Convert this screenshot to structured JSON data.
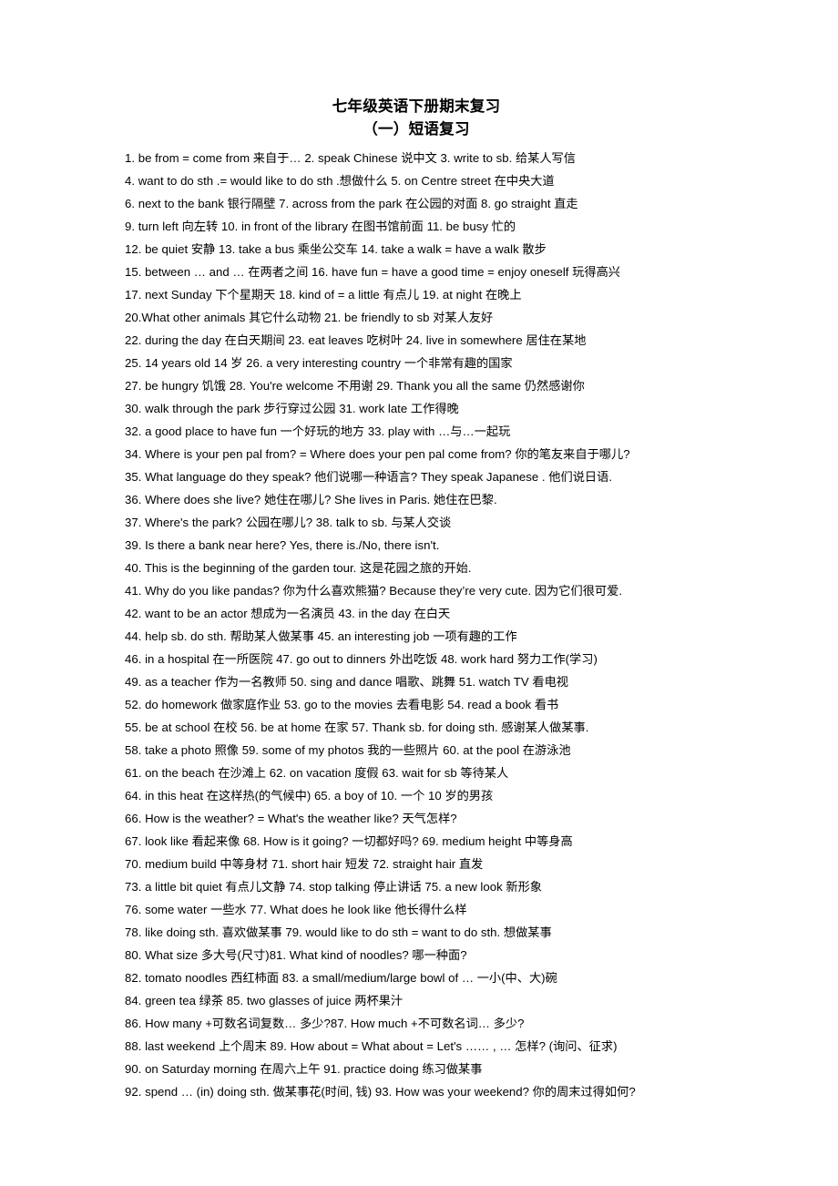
{
  "document": {
    "title_lines": [
      "七年级英语下册期末复习",
      "（一）短语复习"
    ],
    "lines": [
      "1. be from = come from 来自于…     2. speak Chinese 说中文   3. write to sb. 给某人写信",
      "4. want to do sth .= would like to do sth .想做什么      5. on Centre street 在中央大道",
      "6. next to the bank 银行隔壁   7. across from the park 在公园的对面   8. go straight 直走",
      "9. turn left 向左转     10. in front of the library 在图书馆前面     11. be busy 忙的",
      "12. be quiet 安静   13. take a bus 乘坐公交车      14. take a walk = have a walk 散步",
      "15. between … and … 在两者之间  16. have fun = have a good time = enjoy oneself 玩得高兴",
      "17. next Sunday 下个星期天     18. kind of = a little 有点儿      19. at night 在晚上",
      "20.What other animals 其它什么动物      21. be friendly to sb 对某人友好",
      "22. during the day 在白天期间     23. eat leaves 吃树叶    24. live in somewhere 居住在某地",
      "25. 14 years old  14 岁           26. a very interesting country 一个非常有趣的国家",
      "27. be hungry 饥饿   28. You're welcome 不用谢   29. Thank you all the same 仍然感谢你",
      "30. walk through the park 步行穿过公园      31. work late 工作得晚",
      "32. a good place to have fun 一个好玩的地方       33. play with …与…一起玩",
      "34. Where is your pen pal from? = Where does your pen pal come from?  你的笔友来自于哪儿?",
      "35. What language do they speak? 他们说哪一种语言?   They speak Japanese . 他们说日语.",
      "36. Where does she live? 她住在哪儿?      She lives in Paris. 她住在巴黎.",
      "37. Where's the park? 公园在哪儿?      38. talk to sb. 与某人交谈",
      "39. Is there a bank near here? Yes, there is./No, there isn't.",
      "40. This is the beginning of the garden tour. 这是花园之旅的开始.",
      "41. Why do you like pandas? 你为什么喜欢熊猫?  Because they’re very cute. 因为它们很可爱.",
      "42. want to be an actor 想成为一名演员       43. in the day 在白天",
      "44. help sb. do sth. 帮助某人做某事    45. an interesting job 一项有趣的工作",
      "46. in a hospital 在一所医院  47. go out to dinners 外出吃饭  48. work hard 努力工作(学习)",
      "49. as a teacher 作为一名教师   50. sing and dance 唱歌、跳舞    51. watch TV 看电视",
      "52. do homework 做家庭作业  53. go to the movies 去看电影    54. read a book 看书",
      "55. be at school 在校  56. be at home 在家  57. Thank sb. for doing sth. 感谢某人做某事.",
      "58. take a photo 照像    59. some of my photos 我的一些照片    60. at the pool 在游泳池",
      "61. on the beach 在沙滩上   62. on vacation 度假    63. wait for sb 等待某人",
      "64. in this heat 在这样热(的气候中)     65. a boy of 10.  一个 10 岁的男孩",
      "66. How is the weather? = What's the weather like? 天气怎样?",
      "67. look like 看起来像 68. How is it going? 一切都好吗? 69. medium height 中等身高",
      "70. medium build 中等身材 71. short hair 短发    72. straight hair 直发",
      "73. a little bit quiet 有点儿文静 74. stop talking 停止讲话    75. a new look 新形象",
      "76. some water 一些水 77. What does he look like 他长得什么样",
      "78. like doing sth. 喜欢做某事 79. would like to do sth = want to do sth. 想做某事",
      "80. What size 多大号(尺寸)81. What kind of noodles? 哪一种面?",
      "82. tomato noodles 西红柿面 83. a small/medium/large bowl of … 一小(中、大)碗",
      "84. green tea 绿茶 85. two glasses of juice 两杯果汁",
      "86. How many +可数名词复数… 多少?87. How much +不可数名词… 多少?",
      "88. last weekend 上个周末  89. How about = What about = Let's …… , … 怎样? (询问、征求)",
      "90. on Saturday morning 在周六上午          91. practice doing 练习做某事",
      "92. spend … (in) doing sth. 做某事花(时间, 钱) 93. How was your weekend? 你的周末过得如何?"
    ]
  }
}
